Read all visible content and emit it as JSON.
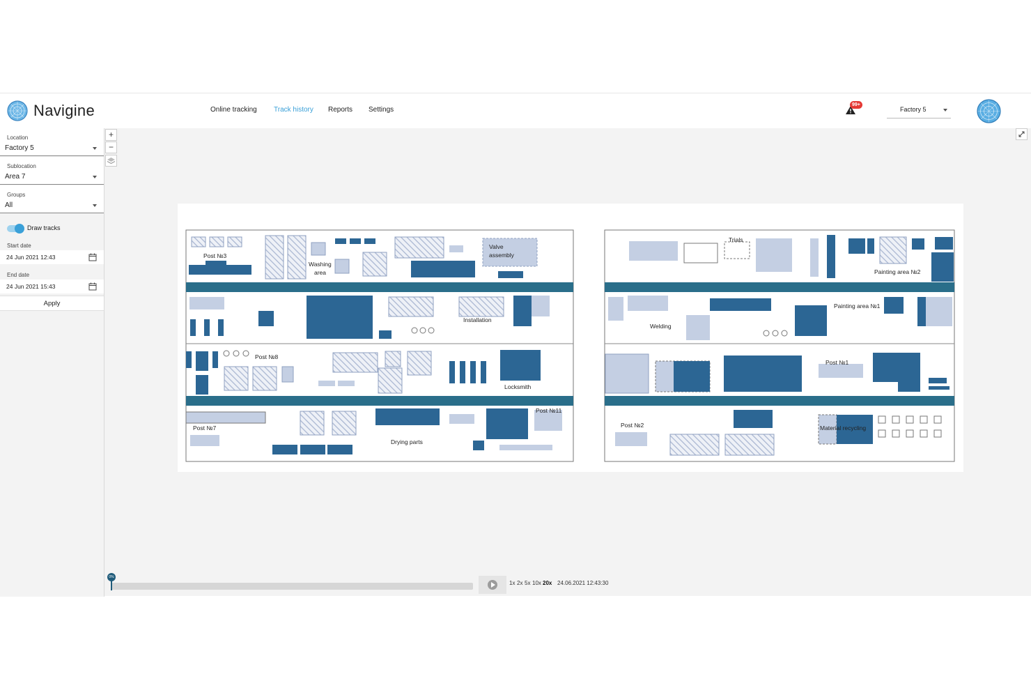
{
  "app": {
    "brand": "Navigine",
    "accent": "#3aa0d8",
    "map_dark": "#2c6694",
    "map_light": "#c4cfe3",
    "corridor": "#2a6e8a"
  },
  "nav": [
    {
      "label": "Online tracking",
      "active": false
    },
    {
      "label": "Track history",
      "active": true
    },
    {
      "label": "Reports",
      "active": false
    },
    {
      "label": "Settings",
      "active": false
    }
  ],
  "notifications": {
    "count": "99+",
    "icon": "warning-icon"
  },
  "factory_select": {
    "value": "Factory 5"
  },
  "sidebar": {
    "location": {
      "label": "Location",
      "value": "Factory 5"
    },
    "sublocation": {
      "label": "Sublocation",
      "value": "Area 7"
    },
    "groups": {
      "label": "Groups",
      "value": "All"
    },
    "draw_tracks": {
      "label": "Draw tracks",
      "on": true
    },
    "start_date": {
      "label": "Start date",
      "value": "24 Jun 2021 12:43"
    },
    "end_date": {
      "label": "End date",
      "value": "24 Jun 2021 15:43"
    },
    "apply": "Apply"
  },
  "map_controls": {
    "zoom_in": "+",
    "zoom_out": "−"
  },
  "map_labels": {
    "post3": "Post №3",
    "washing": "Washing",
    "washing2": "area",
    "valve": "Valve",
    "valve2": "assembly",
    "trials": "Trials",
    "painting2": "Painting area №2",
    "installation": "Installation",
    "painting1": "Painting area №1",
    "welding": "Welding",
    "post8": "Post №8",
    "locksmith": "Locksmith",
    "post1": "Post №1",
    "post7": "Post №7",
    "post11": "Post №11",
    "drying": "Drying parts",
    "post2": "Post №2",
    "recycling": "Material recycling"
  },
  "playback": {
    "marker": "0%",
    "speeds": [
      {
        "label": "1x",
        "active": false
      },
      {
        "label": "2x",
        "active": false
      },
      {
        "label": "5x",
        "active": false
      },
      {
        "label": "10x",
        "active": false
      },
      {
        "label": "20x",
        "active": true
      }
    ],
    "timestamp": "24.06.2021 12:43:30"
  }
}
